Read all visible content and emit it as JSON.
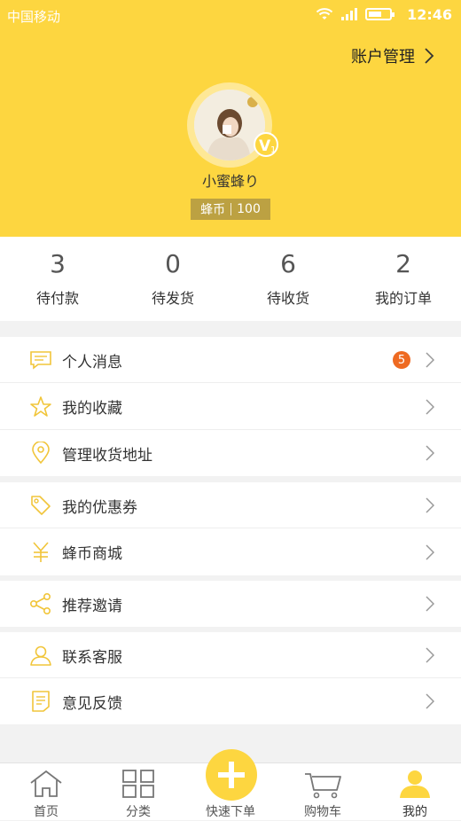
{
  "status_bar": {
    "carrier": "中国移动",
    "time": "12:46"
  },
  "header": {
    "account_link": "账户管理",
    "nickname": "小蜜蜂り",
    "vip_level": "V1",
    "coin_label": "蜂币",
    "coin_value": "100"
  },
  "orders": [
    {
      "count": "3",
      "label": "待付款"
    },
    {
      "count": "0",
      "label": "待发货"
    },
    {
      "count": "6",
      "label": "待收货"
    },
    {
      "count": "2",
      "label": "我的订单"
    }
  ],
  "menu": {
    "messages": {
      "label": "个人消息",
      "badge": "5"
    },
    "favorites": {
      "label": "我的收藏"
    },
    "address": {
      "label": "管理收货地址"
    },
    "coupons": {
      "label": "我的优惠券"
    },
    "coin_mall": {
      "label": "蜂币商城"
    },
    "invite": {
      "label": "推荐邀请"
    },
    "service": {
      "label": "联系客服"
    },
    "feedback": {
      "label": "意见反馈"
    }
  },
  "tabs": [
    {
      "label": "首页",
      "icon": "home-icon"
    },
    {
      "label": "分类",
      "icon": "grid-icon"
    },
    {
      "label": "快速下单",
      "icon": "plus-icon"
    },
    {
      "label": "购物车",
      "icon": "cart-icon"
    },
    {
      "label": "我的",
      "icon": "user-icon"
    }
  ],
  "colors": {
    "accent": "#fdd640",
    "badge": "#ee6a22",
    "coin_bg": "#bca142"
  }
}
